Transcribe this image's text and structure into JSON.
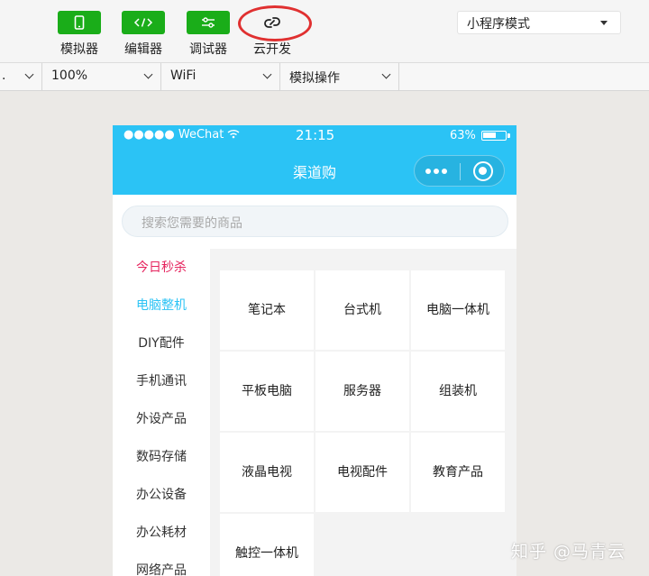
{
  "toolbar": {
    "tools": [
      {
        "label": "模拟器",
        "icon": "phone-icon"
      },
      {
        "label": "编辑器",
        "icon": "code-icon"
      },
      {
        "label": "调试器",
        "icon": "sliders-icon"
      },
      {
        "label": "云开发",
        "icon": "cloud-link-icon"
      }
    ],
    "mode_select": "小程序模式",
    "accent": "#1aad19"
  },
  "subbar": {
    "device": ".",
    "zoom": "100%",
    "network": "WiFi",
    "simulate": "模拟操作"
  },
  "phone": {
    "status": {
      "carrier": "●●●●● WeChat",
      "time": "21:15",
      "battery": "63%",
      "battery_level": 0.63
    },
    "nav_title": "渠道购",
    "search_placeholder": "搜索您需要的商品",
    "categories": [
      "今日秒杀",
      "电脑整机",
      "DIY配件",
      "手机通讯",
      "外设产品",
      "数码存储",
      "办公设备",
      "办公耗材",
      "网络产品"
    ],
    "products": [
      "笔记本",
      "台式机",
      "电脑一体机",
      "平板电脑",
      "服务器",
      "组装机",
      "液晶电视",
      "电视配件",
      "教育产品",
      "触控一体机"
    ],
    "theme_color": "#2bc3f5",
    "flash_color": "#e5245e"
  },
  "watermark": "知乎 @马青云"
}
